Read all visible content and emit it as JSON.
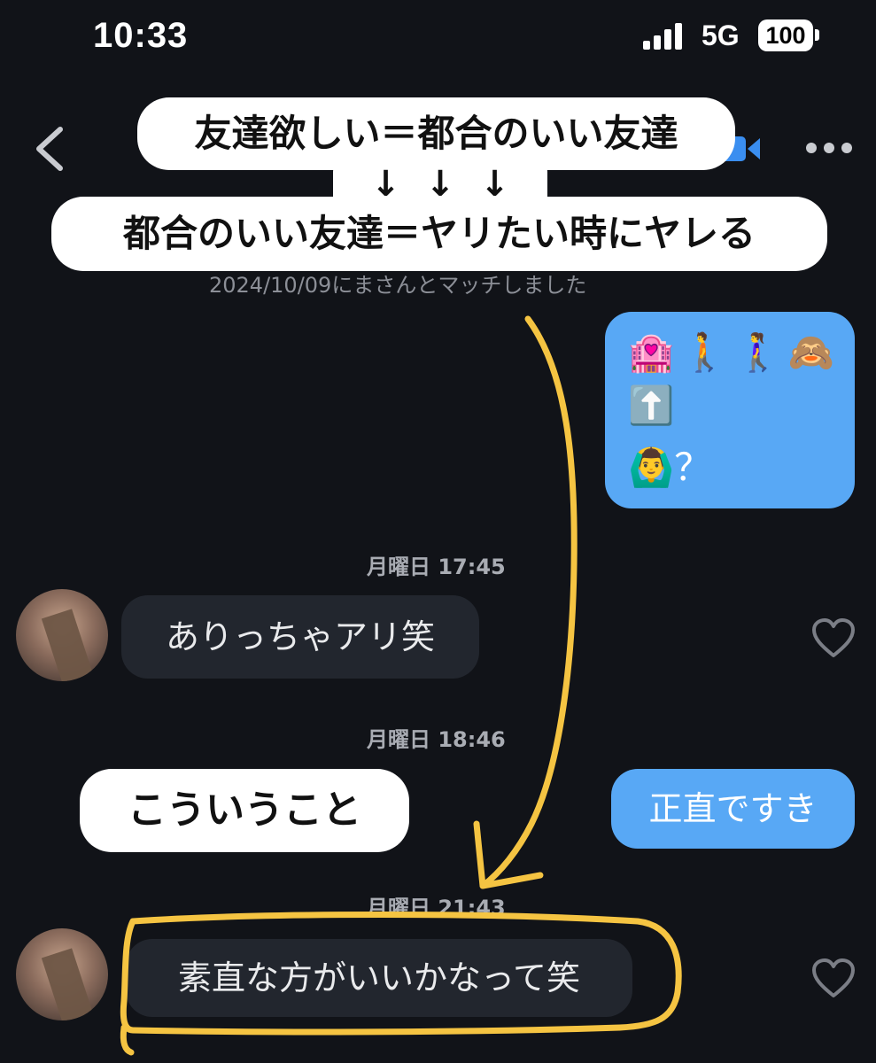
{
  "status_bar": {
    "time": "10:33",
    "network": "5G",
    "battery": "100"
  },
  "header": {
    "back_icon": "chevron-left-icon",
    "video_icon": "video-camera-icon",
    "more_icon": "more-dots-icon"
  },
  "captions": {
    "top": "友達欲しい＝都合のいい友達",
    "arrows": [
      "↓",
      "↓",
      "↓"
    ],
    "mid": "都合のいい友達＝ヤリたい時にヤレる",
    "left": "こういうこと"
  },
  "chat": {
    "match_notice": "2024/10/09にまさんとマッチしました",
    "outgoing_emoji": {
      "line1": "🏩🚶🚶‍♀️🙈",
      "line2": "⬆️",
      "line3": "🙆‍♂️？"
    },
    "messages": [
      {
        "timestamp": "月曜日 17:45",
        "text": "ありっちゃアリ笑",
        "direction": "incoming"
      },
      {
        "timestamp": "月曜日 18:46",
        "text": "正直ですき",
        "direction": "outgoing"
      },
      {
        "timestamp": "月曜日 21:43",
        "text": "素直な方がいいかなって笑",
        "direction": "incoming"
      }
    ]
  },
  "colors": {
    "background": "#111318",
    "outgoing_bubble": "#58a8f5",
    "incoming_bubble": "#22262e",
    "annotation": "#f5c442"
  }
}
